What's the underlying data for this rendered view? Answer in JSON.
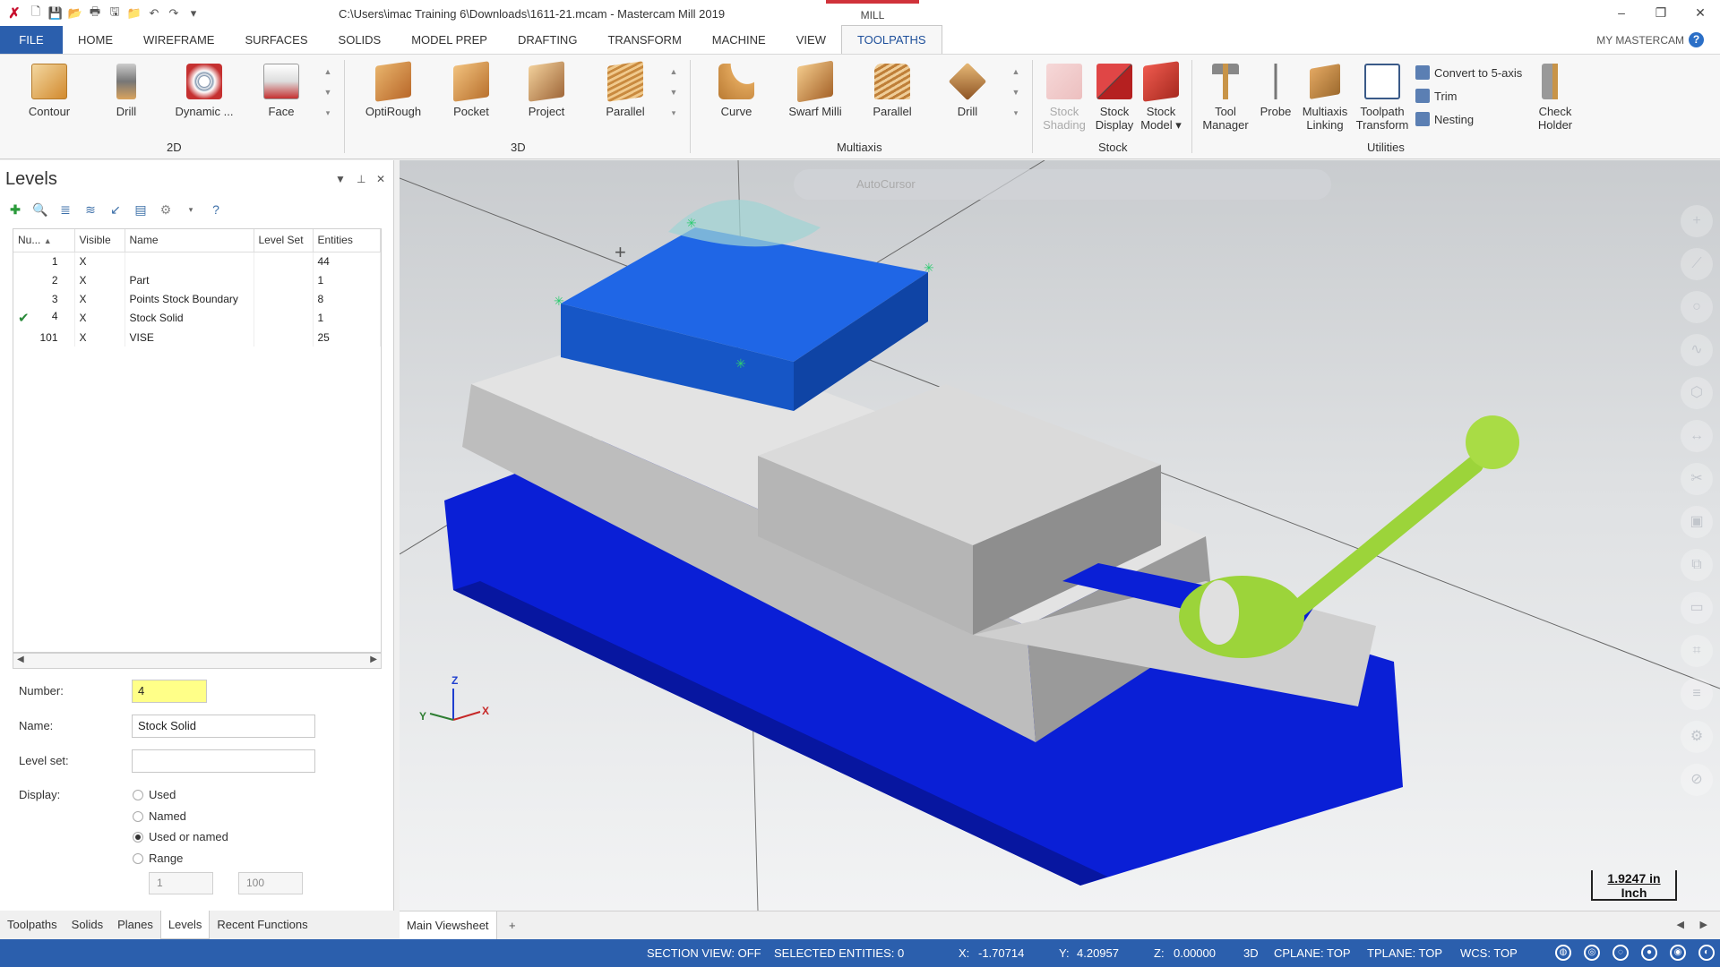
{
  "window": {
    "title": "C:\\Users\\imac Training 6\\Downloads\\1611-21.mcam - Mastercam Mill 2019",
    "context_tab": "MILL",
    "controls": [
      "–",
      "❐",
      "✕"
    ]
  },
  "menu": {
    "file": "FILE",
    "items": [
      "HOME",
      "WIREFRAME",
      "SURFACES",
      "SOLIDS",
      "MODEL PREP",
      "DRAFTING",
      "TRANSFORM",
      "MACHINE",
      "VIEW",
      "TOOLPATHS"
    ],
    "active": "TOOLPATHS",
    "my_mastercam": "MY MASTERCAM",
    "help": "?"
  },
  "ribbon": {
    "groups": {
      "g2d": "2D",
      "g3d": "3D",
      "multiaxis": "Multiaxis",
      "stock": "Stock",
      "utilities": "Utilities"
    },
    "buttons_2d": [
      "Contour",
      "Drill",
      "Dynamic ...",
      "Face"
    ],
    "buttons_3d": [
      "OptiRough",
      "Pocket",
      "Project",
      "Parallel"
    ],
    "buttons_multi": [
      "Curve",
      "Swarf Milli",
      "Parallel",
      "Drill"
    ],
    "stock_shading": [
      "Stock",
      "Shading"
    ],
    "stock_display": [
      "Stock",
      "Display"
    ],
    "stock_model": [
      "Stock",
      "Model ▾"
    ],
    "tool_manager": [
      "Tool",
      "Manager"
    ],
    "probe": "Probe",
    "multiaxis_linking": [
      "Multiaxis",
      "Linking"
    ],
    "toolpath_transform": [
      "Toolpath",
      "Transform"
    ],
    "convert": "Convert to 5-axis",
    "trim": "Trim",
    "nesting": "Nesting",
    "check_holder": [
      "Check",
      "Holder"
    ]
  },
  "levels": {
    "title": "Levels",
    "columns": [
      "Nu...",
      "Visible",
      "Name",
      "Level Set",
      "Entities"
    ],
    "rows": [
      {
        "num": "1",
        "visible": "X",
        "name": "",
        "set": "",
        "entities": "44",
        "check": ""
      },
      {
        "num": "2",
        "visible": "X",
        "name": "Part",
        "set": "",
        "entities": "1",
        "check": ""
      },
      {
        "num": "3",
        "visible": "X",
        "name": "Points Stock Boundary",
        "set": "",
        "entities": "8",
        "check": ""
      },
      {
        "num": "4",
        "visible": "X",
        "name": "Stock Solid",
        "set": "",
        "entities": "1",
        "check": "✔"
      },
      {
        "num": "101",
        "visible": "X",
        "name": "VISE",
        "set": "",
        "entities": "25",
        "check": ""
      }
    ],
    "form": {
      "number_label": "Number:",
      "number_value": "4",
      "name_label": "Name:",
      "name_value": "Stock Solid",
      "levelset_label": "Level set:",
      "levelset_value": "",
      "display_label": "Display:",
      "display_options": [
        "Used",
        "Named",
        "Used or named",
        "Range"
      ],
      "display_selected": "Used or named",
      "range_from": "1",
      "range_to": "100"
    }
  },
  "bottom_tabs": [
    "Toolpaths",
    "Solids",
    "Planes",
    "Levels",
    "Recent Functions"
  ],
  "active_bottom_tab": "Levels",
  "viewport": {
    "autocursor": "AutoCursor",
    "scale_value": "1.9247 in",
    "scale_unit": "Inch",
    "axes": {
      "x": "X",
      "y": "Y",
      "z": "Z"
    }
  },
  "viewsheet": {
    "tab": "Main Viewsheet",
    "add": "+"
  },
  "status": {
    "section_view": "SECTION VIEW: OFF",
    "selected": "SELECTED ENTITIES: 0",
    "x_label": "X:",
    "x": "-1.70714",
    "y_label": "Y:",
    "y": "4.20957",
    "z_label": "Z:",
    "z": "0.00000",
    "mode": "3D",
    "cplane": "CPLANE: TOP",
    "tplane": "TPLANE: TOP",
    "wcs": "WCS: TOP"
  },
  "colors": {
    "accent_blue": "#2b5fad",
    "vise_blue": "#0a1fd6",
    "stock_blue": "#1a64e0",
    "handle_green": "#9cd43a"
  }
}
